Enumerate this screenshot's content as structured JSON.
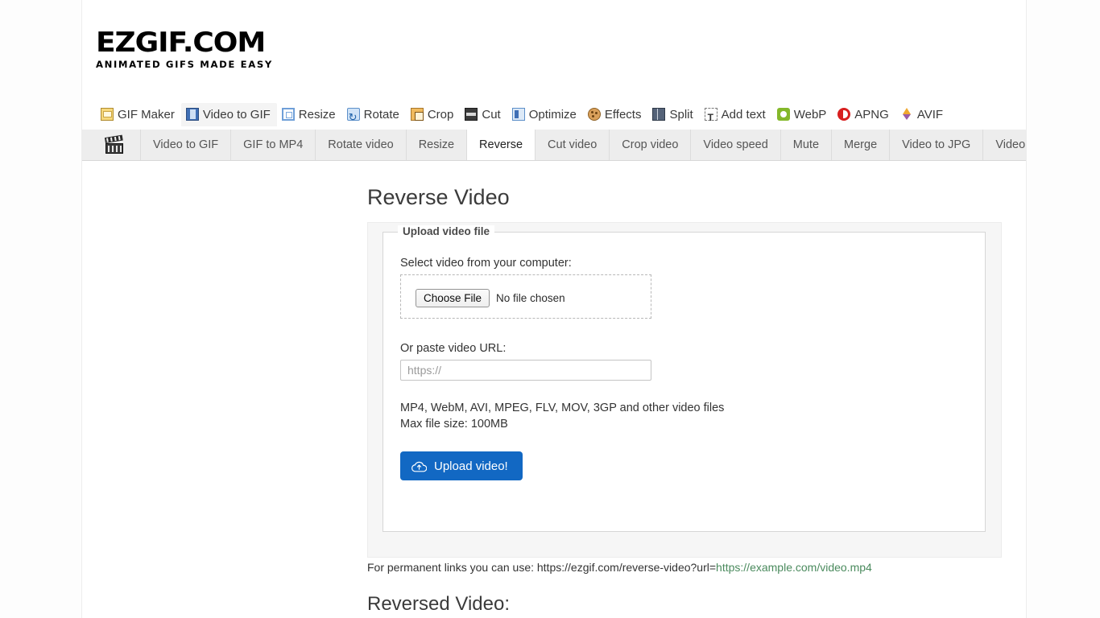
{
  "site": {
    "logo_main": "EZGIF.COM",
    "logo_sub": "ANIMATED GIFS MADE EASY"
  },
  "main_nav": {
    "items": [
      {
        "label": "GIF Maker",
        "icon": "gif-maker-icon",
        "icon_class": "ic-gifmaker",
        "active": false
      },
      {
        "label": "Video to GIF",
        "icon": "video-to-gif-icon",
        "icon_class": "ic-videogif",
        "active": true
      },
      {
        "label": "Resize",
        "icon": "resize-icon",
        "icon_class": "ic-resize",
        "active": false
      },
      {
        "label": "Rotate",
        "icon": "rotate-icon",
        "icon_class": "ic-rotate",
        "active": false
      },
      {
        "label": "Crop",
        "icon": "crop-icon",
        "icon_class": "ic-crop",
        "active": false
      },
      {
        "label": "Cut",
        "icon": "cut-icon",
        "icon_class": "ic-cut",
        "active": false
      },
      {
        "label": "Optimize",
        "icon": "optimize-icon",
        "icon_class": "ic-optimize",
        "active": false
      },
      {
        "label": "Effects",
        "icon": "effects-icon",
        "icon_class": "ic-effects",
        "active": false
      },
      {
        "label": "Split",
        "icon": "split-icon",
        "icon_class": "ic-split",
        "active": false
      },
      {
        "label": "Add text",
        "icon": "add-text-icon",
        "icon_class": "ic-addtext",
        "active": false
      },
      {
        "label": "WebP",
        "icon": "webp-icon",
        "icon_class": "ic-webp",
        "active": false
      },
      {
        "label": "APNG",
        "icon": "apng-icon",
        "icon_class": "ic-apng",
        "active": false
      },
      {
        "label": "AVIF",
        "icon": "avif-icon",
        "icon_class": "ic-avif",
        "active": false
      }
    ]
  },
  "sub_nav": {
    "icon": "clapperboard-icon",
    "items": [
      {
        "label": "Video to GIF",
        "active": false
      },
      {
        "label": "GIF to MP4",
        "active": false
      },
      {
        "label": "Rotate video",
        "active": false
      },
      {
        "label": "Resize",
        "active": false
      },
      {
        "label": "Reverse",
        "active": true
      },
      {
        "label": "Cut video",
        "active": false
      },
      {
        "label": "Crop video",
        "active": false
      },
      {
        "label": "Video speed",
        "active": false
      },
      {
        "label": "Mute",
        "active": false
      },
      {
        "label": "Merge",
        "active": false
      },
      {
        "label": "Video to JPG",
        "active": false
      },
      {
        "label": "Video to PNG",
        "active": false
      }
    ]
  },
  "main": {
    "page_title": "Reverse Video",
    "upload": {
      "legend": "Upload video file",
      "file_label": "Select video from your computer:",
      "choose_file_button": "Choose File",
      "file_status": "No file chosen",
      "url_label": "Or paste video URL:",
      "url_value": "",
      "url_placeholder": "https://",
      "formats_line": "MP4, WebM, AVI, MPEG, FLV, MOV, 3GP and other video files",
      "maxsize_line": "Max file size: 100MB",
      "submit_label": "Upload video!",
      "submit_icon": "cloud-upload-icon",
      "submit_color": "#1268c3"
    },
    "permanent_links": {
      "prefix": "For permanent links you can use: https://ezgif.com/reverse-video?url=",
      "url": "https://example.com/video.mp4",
      "url_color": "#4a8a5d"
    },
    "result_title": "Reversed Video:"
  }
}
